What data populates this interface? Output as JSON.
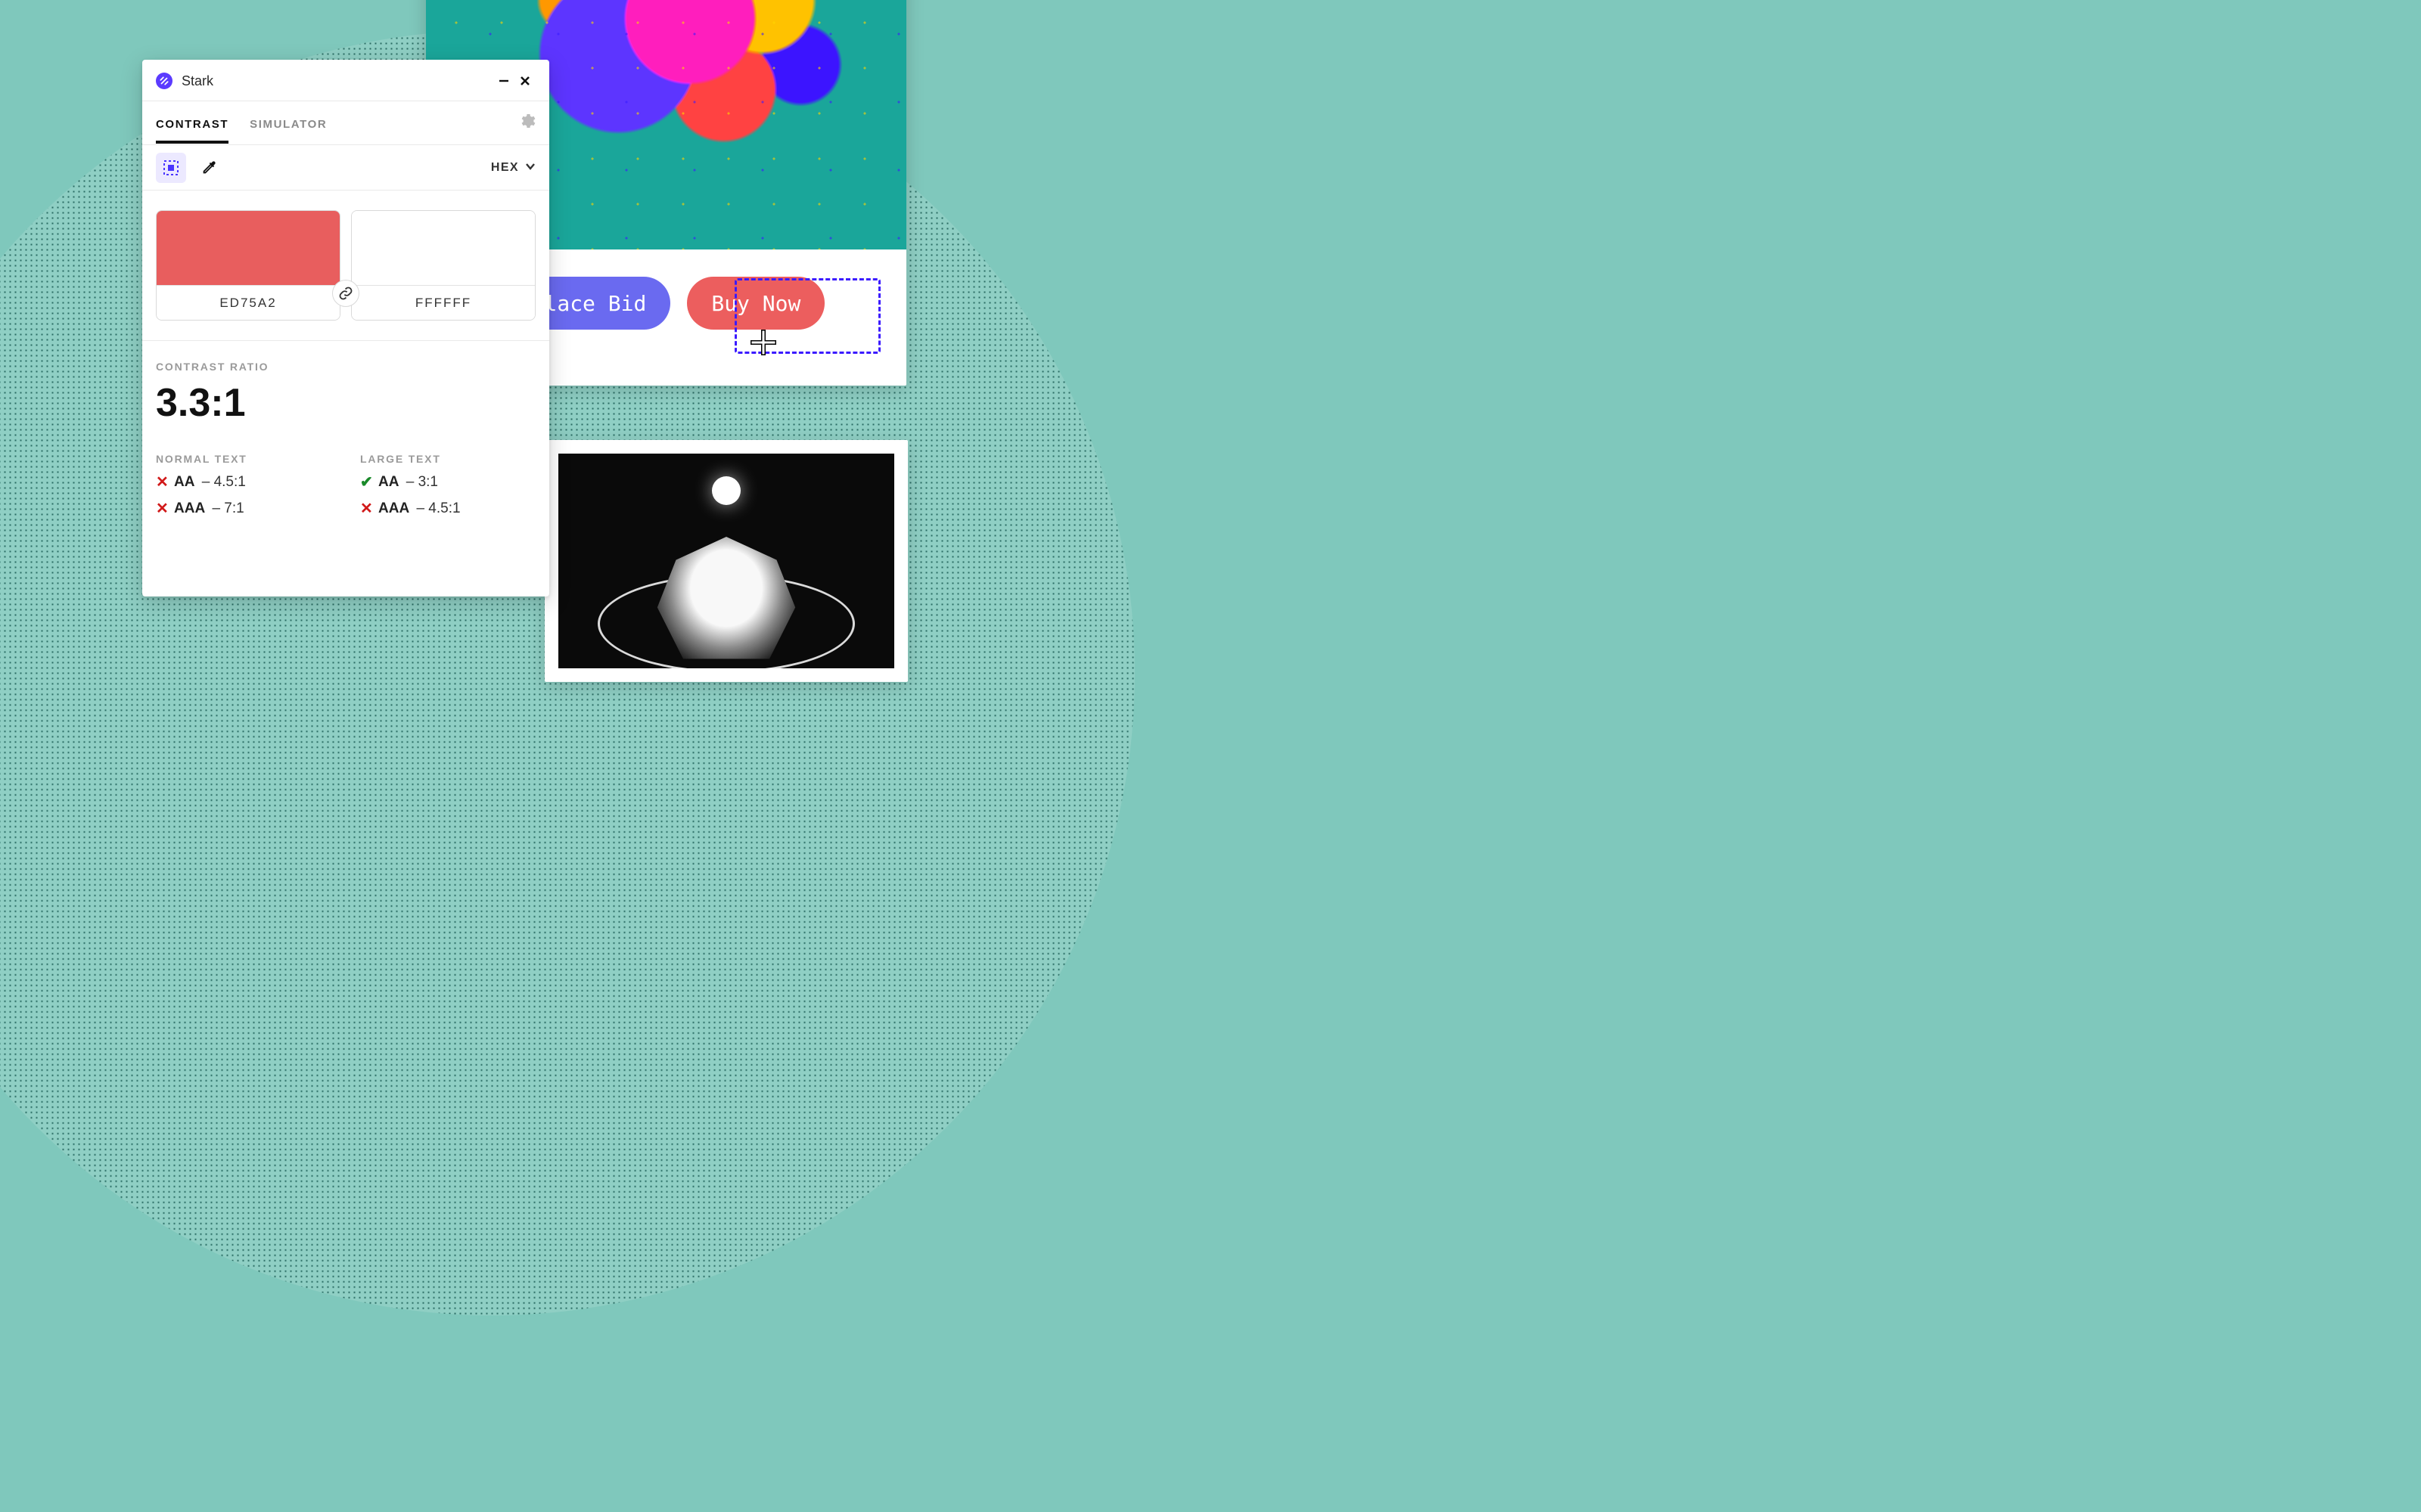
{
  "app": {
    "title": "Stark"
  },
  "tabs": {
    "contrast": "CONTRAST",
    "simulator": "SIMULATOR"
  },
  "color_format": "HEX",
  "swatches": {
    "fg": {
      "hex": "ED75A2",
      "css": "#e85e5e"
    },
    "bg": {
      "hex": "FFFFFF",
      "css": "#ffffff"
    }
  },
  "ratio_label": "CONTRAST RATIO",
  "ratio_value": "3.3:1",
  "normal": {
    "label": "NORMAL TEXT",
    "aa": {
      "level": "AA",
      "threshold": "4.5:1",
      "pass": false
    },
    "aaa": {
      "level": "AAA",
      "threshold": "7:1",
      "pass": false
    }
  },
  "large": {
    "label": "LARGE TEXT",
    "aa": {
      "level": "AA",
      "threshold": "3:1",
      "pass": true
    },
    "aaa": {
      "level": "AAA",
      "threshold": "4.5:1",
      "pass": false
    }
  },
  "canvas": {
    "place_bid": "Place Bid",
    "buy_now": "Buy Now"
  },
  "colors": {
    "accent_purple": "#5b3bff",
    "fail_red": "#d11919",
    "pass_green": "#1a8a2a",
    "bid_bg": "#6a6af0",
    "buy_bg": "#ec5e5e"
  }
}
